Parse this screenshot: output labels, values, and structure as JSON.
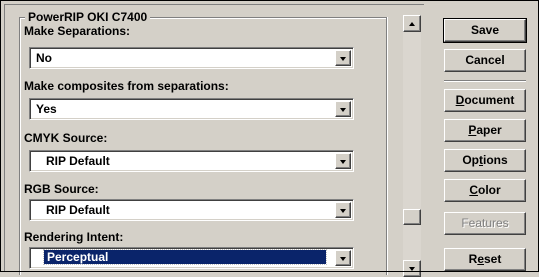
{
  "group": {
    "title": "PowerRIP OKI C7400"
  },
  "fields": [
    {
      "label": "Make Separations:",
      "value": "No"
    },
    {
      "label": "Make composites from separations:",
      "value": "Yes"
    },
    {
      "label": "CMYK Source:",
      "value": "RIP Default"
    },
    {
      "label": "RGB Source:",
      "value": "RIP Default"
    },
    {
      "label": "Rendering Intent:",
      "value": "Perceptual"
    }
  ],
  "buttons": {
    "save": "Save",
    "cancel": "Cancel",
    "document": {
      "pre": "",
      "key": "D",
      "post": "ocument"
    },
    "paper": {
      "pre": "",
      "key": "P",
      "post": "aper"
    },
    "options": {
      "pre": "Op",
      "key": "t",
      "post": "ions"
    },
    "color": {
      "pre": "",
      "key": "C",
      "post": "olor"
    },
    "features": "Features",
    "reset": {
      "pre": "R",
      "key": "e",
      "post": "set"
    }
  },
  "icons": {
    "dropdown": "chevron-down-icon",
    "scroll_up": "arrow-up-icon",
    "scroll_down": "arrow-down-icon"
  },
  "colors": {
    "face": "#d4d0c8",
    "selection": "#0a246a",
    "disabled_text": "#808080"
  }
}
